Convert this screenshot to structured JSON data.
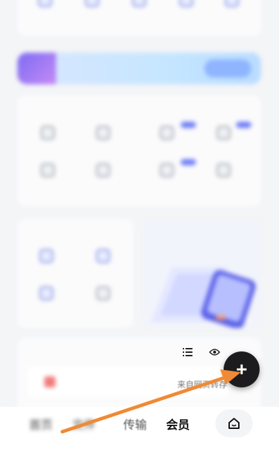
{
  "top_row": {
    "items": [
      {
        "label": "",
        "icon": "file-icon"
      },
      {
        "label": "",
        "icon": "image-icon"
      },
      {
        "label": "",
        "icon": "video-icon"
      },
      {
        "label": "",
        "icon": "doc-icon"
      },
      {
        "label": "",
        "icon": "more-icon"
      }
    ]
  },
  "banner": {
    "text": "",
    "button": ""
  },
  "common_tools": {
    "title": "",
    "items": [
      {
        "label": ""
      },
      {
        "label": ""
      },
      {
        "label": ""
      },
      {
        "label": ""
      }
    ]
  },
  "ai_tools": {
    "title": "",
    "items": [
      {
        "label": ""
      },
      {
        "label": ""
      },
      {
        "label": ""
      },
      {
        "label": ""
      }
    ]
  },
  "featured": {
    "title": "",
    "items": [
      {
        "label": ""
      },
      {
        "label": ""
      },
      {
        "label": ""
      },
      {
        "label": ""
      }
    ]
  },
  "promo_card": {
    "title": "",
    "subtitle": ""
  },
  "recent": {
    "title": "",
    "file_name": "",
    "save_hint": "来自网页转存"
  },
  "bottom_nav": {
    "items": [
      {
        "label": "首页"
      },
      {
        "label": "文件"
      },
      {
        "label": "传输"
      },
      {
        "label": "会员"
      }
    ]
  },
  "fab_symbol": "+",
  "colors": {
    "accent": "#6d7cf6",
    "fab": "#1c1c1e",
    "arrow": "#f08a34"
  }
}
